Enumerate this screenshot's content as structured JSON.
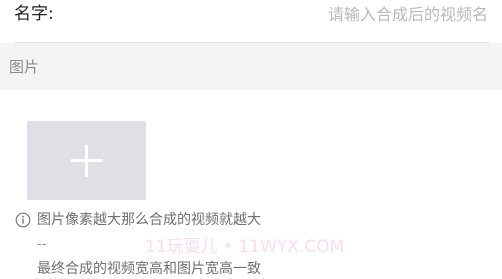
{
  "form": {
    "name_label": "名字:",
    "name_placeholder": "请输入合成后的视频名",
    "name_value": ""
  },
  "images_section": {
    "title": "图片",
    "upload_icon": "plus-icon"
  },
  "tips": {
    "icon": "info-circle-icon",
    "line1": "图片像素越大那么合成的视频就越大",
    "dashes": "--",
    "line2_partial": "最终合成的视频宽高和图片宽高一致"
  },
  "watermark": "11玩耍儿 • 11WYX.COM"
}
